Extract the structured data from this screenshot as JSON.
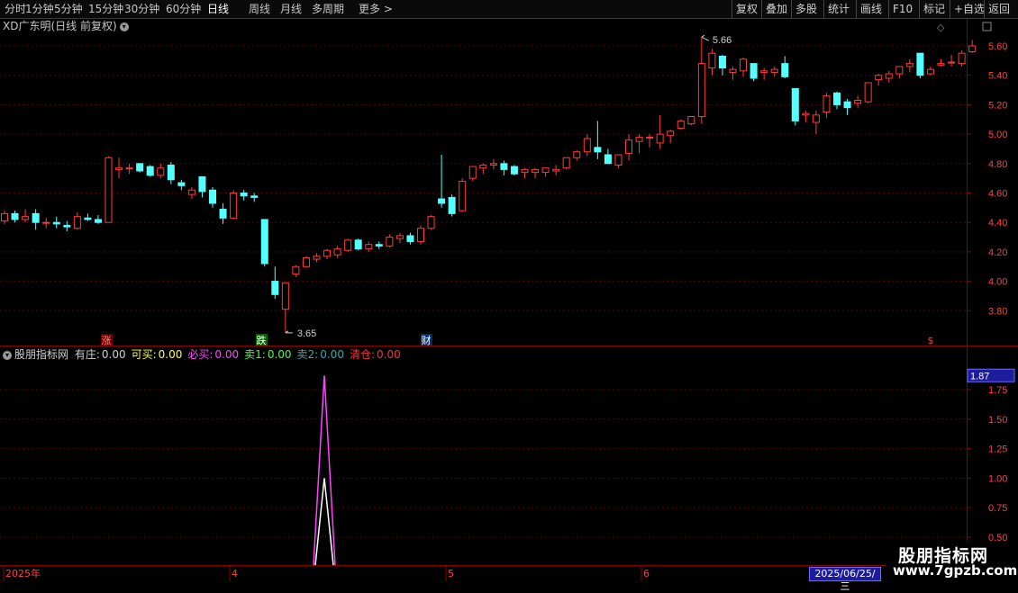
{
  "toolbar": {
    "periods": [
      "分时",
      "1分钟",
      "5分钟",
      "15分钟",
      "30分钟",
      "60分钟",
      "日线",
      "周线",
      "月线",
      "多周期",
      "更多 >"
    ],
    "active": "日线",
    "right_buttons": [
      "复权",
      "叠加",
      "多股",
      "统计",
      "画线",
      "F10",
      "标记",
      "+自选",
      "返回"
    ]
  },
  "main_chart": {
    "title": "XD广东明(日线 前复权)",
    "price_axis": [
      "5.60",
      "5.40",
      "5.20",
      "5.00",
      "4.80",
      "4.60",
      "4.40",
      "4.20",
      "4.00",
      "3.80"
    ],
    "high_label": "5.66",
    "low_label": "3.65",
    "markers": [
      "涨",
      "跌",
      "财",
      "$"
    ],
    "colors": {
      "up": "#ff3b3b",
      "down": "#54ffff",
      "grid": "#5a0000",
      "axis": "#8b0000"
    }
  },
  "sub_chart": {
    "name": "股朋指标网",
    "fields": [
      {
        "label": "有庄:",
        "value": "0.00",
        "color": "#d0d0d0"
      },
      {
        "label": "可买:",
        "value": "0.00",
        "color": "#ffff55"
      },
      {
        "label": "必买:",
        "value": "0.00",
        "color": "#ff44ff"
      },
      {
        "label": "卖1:",
        "value": "0.00",
        "color": "#44ff44"
      },
      {
        "label": "卖2:",
        "value": "0.00",
        "color": "#33aaaa"
      },
      {
        "label": "清仓:",
        "value": "0.00",
        "color": "#ff3333"
      }
    ],
    "axis_labels": [
      "1.75",
      "1.50",
      "1.25",
      "1.00",
      "0.75",
      "0.50"
    ],
    "current_value": "1.87"
  },
  "time_axis": {
    "labels": [
      "2025年",
      "4",
      "5",
      "6"
    ],
    "current_date": "2025/06/25/三"
  },
  "watermark": {
    "line1": "股朋指标网",
    "line2": "www.7gpzb.com"
  },
  "chart_data": {
    "type": "candlestick",
    "ylim": [
      3.65,
      5.7
    ],
    "candles": [
      [
        4.41,
        4.48,
        4.39,
        4.46
      ],
      [
        4.46,
        4.48,
        4.4,
        4.42
      ],
      [
        4.42,
        4.49,
        4.4,
        4.44
      ],
      [
        4.46,
        4.49,
        4.35,
        4.4
      ],
      [
        4.4,
        4.43,
        4.36,
        4.4
      ],
      [
        4.4,
        4.44,
        4.36,
        4.39
      ],
      [
        4.38,
        4.41,
        4.34,
        4.37
      ],
      [
        4.36,
        4.47,
        4.35,
        4.44
      ],
      [
        4.43,
        4.46,
        4.41,
        4.42
      ],
      [
        4.42,
        4.45,
        4.39,
        4.4
      ],
      [
        4.4,
        4.85,
        4.4,
        4.84
      ],
      [
        4.76,
        4.84,
        4.7,
        4.77
      ],
      [
        4.77,
        4.8,
        4.73,
        4.77
      ],
      [
        4.8,
        4.8,
        4.74,
        4.75
      ],
      [
        4.78,
        4.79,
        4.71,
        4.72
      ],
      [
        4.72,
        4.8,
        4.7,
        4.77
      ],
      [
        4.79,
        4.81,
        4.66,
        4.69
      ],
      [
        4.67,
        4.69,
        4.62,
        4.65
      ],
      [
        4.59,
        4.64,
        4.56,
        4.62
      ],
      [
        4.71,
        4.71,
        4.57,
        4.61
      ],
      [
        4.62,
        4.64,
        4.5,
        4.53
      ],
      [
        4.49,
        4.53,
        4.39,
        4.43
      ],
      [
        4.43,
        4.62,
        4.42,
        4.6
      ],
      [
        4.6,
        4.62,
        4.55,
        4.58
      ],
      [
        4.58,
        4.6,
        4.54,
        4.57
      ],
      [
        4.42,
        4.42,
        4.1,
        4.12
      ],
      [
        4.0,
        4.1,
        3.88,
        3.91
      ],
      [
        3.81,
        3.99,
        3.65,
        3.99
      ],
      [
        4.05,
        4.11,
        4.03,
        4.1
      ],
      [
        4.1,
        4.17,
        4.09,
        4.16
      ],
      [
        4.15,
        4.19,
        4.13,
        4.17
      ],
      [
        4.17,
        4.22,
        4.15,
        4.21
      ],
      [
        4.18,
        4.24,
        4.16,
        4.22
      ],
      [
        4.21,
        4.29,
        4.2,
        4.28
      ],
      [
        4.28,
        4.29,
        4.21,
        4.22
      ],
      [
        4.22,
        4.27,
        4.2,
        4.25
      ],
      [
        4.25,
        4.27,
        4.22,
        4.24
      ],
      [
        4.24,
        4.32,
        4.23,
        4.3
      ],
      [
        4.29,
        4.33,
        4.26,
        4.31
      ],
      [
        4.31,
        4.33,
        4.25,
        4.27
      ],
      [
        4.27,
        4.38,
        4.25,
        4.36
      ],
      [
        4.36,
        4.45,
        4.35,
        4.44
      ],
      [
        4.56,
        4.86,
        4.5,
        4.53
      ],
      [
        4.57,
        4.59,
        4.44,
        4.46
      ],
      [
        4.48,
        4.7,
        4.47,
        4.68
      ],
      [
        4.7,
        4.78,
        4.68,
        4.78
      ],
      [
        4.77,
        4.8,
        4.73,
        4.79
      ],
      [
        4.79,
        4.83,
        4.76,
        4.8
      ],
      [
        4.8,
        4.82,
        4.72,
        4.76
      ],
      [
        4.78,
        4.79,
        4.72,
        4.73
      ],
      [
        4.74,
        4.77,
        4.7,
        4.76
      ],
      [
        4.74,
        4.77,
        4.7,
        4.76
      ],
      [
        4.74,
        4.77,
        4.71,
        4.77
      ],
      [
        4.75,
        4.79,
        4.72,
        4.76
      ],
      [
        4.77,
        4.84,
        4.76,
        4.84
      ],
      [
        4.84,
        4.89,
        4.82,
        4.88
      ],
      [
        4.88,
        5.0,
        4.85,
        4.97
      ],
      [
        4.91,
        5.09,
        4.83,
        4.88
      ],
      [
        4.86,
        4.9,
        4.8,
        4.8
      ],
      [
        4.79,
        4.85,
        4.77,
        4.86
      ],
      [
        4.87,
        5.0,
        4.82,
        4.96
      ],
      [
        4.95,
        5.0,
        4.87,
        4.98
      ],
      [
        4.98,
        5.0,
        4.91,
        4.98
      ],
      [
        4.94,
        5.13,
        4.9,
        5.0
      ],
      [
        4.99,
        5.03,
        4.94,
        5.02
      ],
      [
        5.04,
        5.1,
        5.03,
        5.09
      ],
      [
        5.07,
        5.12,
        5.06,
        5.12
      ],
      [
        5.12,
        5.66,
        5.07,
        5.48
      ],
      [
        5.45,
        5.58,
        5.4,
        5.55
      ],
      [
        5.53,
        5.54,
        5.4,
        5.45
      ],
      [
        5.42,
        5.46,
        5.37,
        5.44
      ],
      [
        5.43,
        5.52,
        5.39,
        5.51
      ],
      [
        5.48,
        5.48,
        5.36,
        5.38
      ],
      [
        5.42,
        5.45,
        5.37,
        5.43
      ],
      [
        5.42,
        5.46,
        5.39,
        5.44
      ],
      [
        5.48,
        5.53,
        5.38,
        5.39
      ],
      [
        5.31,
        5.31,
        5.06,
        5.09
      ],
      [
        5.13,
        5.16,
        5.08,
        5.14
      ],
      [
        5.08,
        5.16,
        5.0,
        5.13
      ],
      [
        5.15,
        5.28,
        5.11,
        5.26
      ],
      [
        5.28,
        5.29,
        5.17,
        5.2
      ],
      [
        5.22,
        5.24,
        5.13,
        5.18
      ],
      [
        5.21,
        5.26,
        5.18,
        5.23
      ],
      [
        5.22,
        5.34,
        5.21,
        5.35
      ],
      [
        5.37,
        5.41,
        5.33,
        5.4
      ],
      [
        5.38,
        5.43,
        5.35,
        5.41
      ],
      [
        5.41,
        5.46,
        5.38,
        5.46
      ],
      [
        5.46,
        5.51,
        5.42,
        5.48
      ],
      [
        5.55,
        5.55,
        5.38,
        5.4
      ],
      [
        5.41,
        5.46,
        5.4,
        5.44
      ],
      [
        5.47,
        5.51,
        5.46,
        5.48
      ],
      [
        5.49,
        5.54,
        5.46,
        5.49
      ],
      [
        5.48,
        5.57,
        5.46,
        5.55
      ],
      [
        5.56,
        5.64,
        5.55,
        5.6
      ]
    ],
    "indicator": {
      "peak_index": 29,
      "peak_value": 1.87,
      "inner_peak_value": 1.0
    }
  }
}
